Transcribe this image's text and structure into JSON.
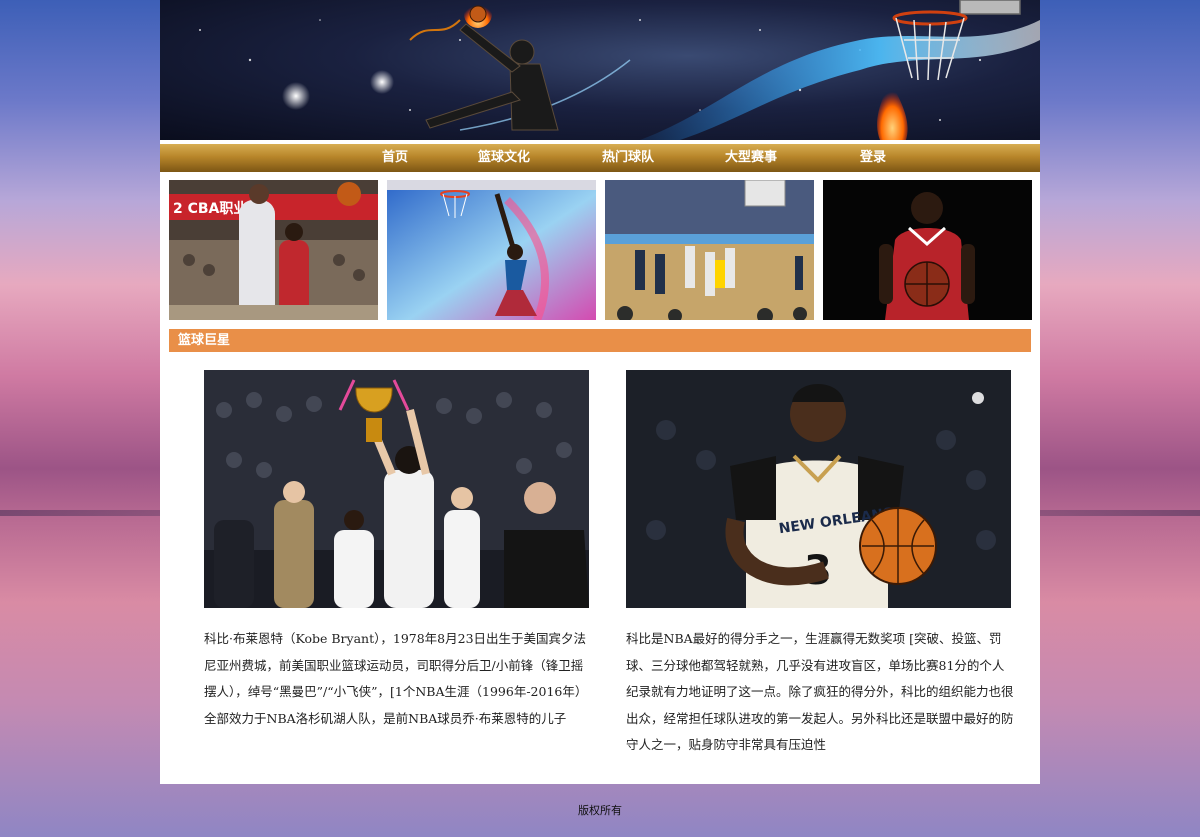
{
  "nav": {
    "items": [
      {
        "label": "首页"
      },
      {
        "label": "篮球文化"
      },
      {
        "label": "热门球队"
      },
      {
        "label": "大型赛事"
      },
      {
        "label": "登录"
      }
    ]
  },
  "thumbnails": [
    {
      "caption": "2 CBA职业篮",
      "icon": "cba-game-photo"
    },
    {
      "caption": "",
      "icon": "dunk-art-photo"
    },
    {
      "caption": "",
      "icon": "arena-game-photo"
    },
    {
      "caption": "",
      "icon": "player-portrait-photo"
    }
  ],
  "section": {
    "title": "篮球巨星"
  },
  "articles": [
    {
      "photo_icon": "trophy-celebration-photo",
      "text": "科比·布莱恩特（Kobe Bryant），1978年8月23日出生于美国宾夕法尼亚州费城，前美国职业篮球运动员，司职得分后卫/小前锋（锋卫摇摆人），绰号“黑曼巴”/“小飞侠”，[1个NBA生涯（1996年-2016年）全部效力于NBA洛杉矶湖人队，是前NBA球员乔·布莱恩特的儿子"
    },
    {
      "photo_icon": "new-orleans-player-photo",
      "jersey_number": "3",
      "jersey_text": "NEW ORLEANS",
      "text": "科比是NBA最好的得分手之一，生涯赢得无数奖项 [突破、投篮、罚球、三分球他都驾轻就熟，几乎没有进攻盲区，单场比赛81分的个人纪录就有力地证明了这一点。除了疯狂的得分外，科比的组织能力也很出众，经常担任球队进攻的第一发起人。另外科比还是联盟中最好的防守人之一，贴身防守非常具有压迫性"
    }
  ],
  "footer": {
    "text": "版权所有"
  },
  "colors": {
    "nav_gold": "#b8862a",
    "section_orange": "#e98f48",
    "page_bg": "#ffffff"
  }
}
